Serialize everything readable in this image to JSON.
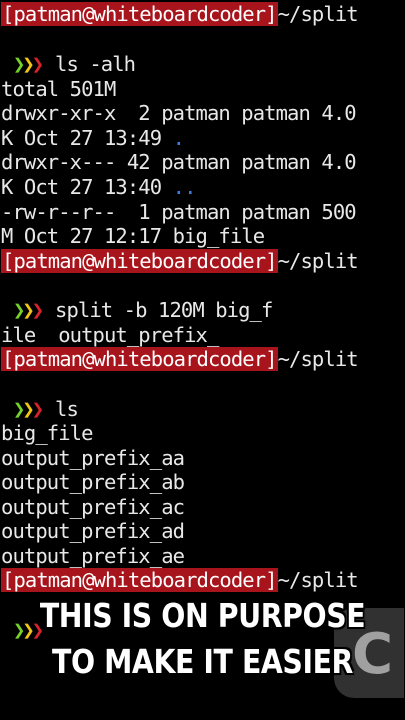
{
  "terminal": {
    "prompt_user": "[patman@whiteboardcoder]",
    "prompt_cwd": "~/split",
    "arrow_glyph": "❯",
    "arrow_colors": [
      "#74d02b",
      "#f0c514",
      "#d8232a"
    ],
    "blocks": [
      {
        "command": "ls -alh",
        "output": [
          "total 501M",
          "drwxr-xr-x  2 patman patman 4.0",
          "K Oct 27 13:49 ",
          "drwxr-x--- 42 patman patman 4.0",
          "K Oct 27 13:40 ",
          "-rw-r--r--  1 patman patman 500",
          "M Oct 27 12:17 big_file"
        ],
        "dir_entries": [
          ".",
          ".."
        ]
      },
      {
        "command": "split -b 120M big_f",
        "command_wrap": "ile  output_prefix_"
      },
      {
        "command": "ls",
        "output": [
          "big_file",
          "output_prefix_aa",
          "output_prefix_ab",
          "output_prefix_ac",
          "output_prefix_ad",
          "output_prefix_ae"
        ]
      }
    ]
  },
  "overlay": {
    "caption_line1": "THIS IS ON PURPOSE",
    "caption_line2": "TO MAKE IT EASIER",
    "logo_mark": "C"
  },
  "colors": {
    "background": "#000000",
    "prompt_bg": "#a8141c",
    "text": "#e8e8e8",
    "dir_blue": "#3d7de0"
  }
}
